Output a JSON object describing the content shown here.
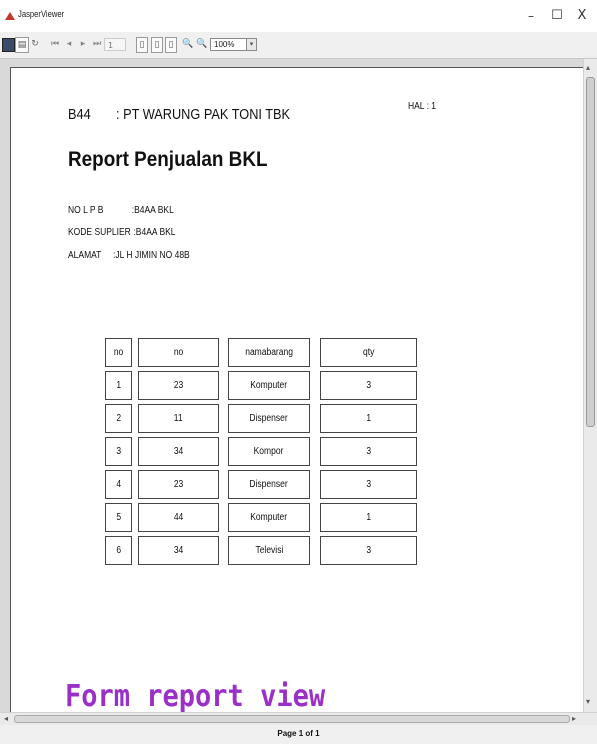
{
  "window": {
    "title": "JasperViewer",
    "minimize_glyph": "–",
    "maximize_glyph": "☐",
    "close_glyph": "X"
  },
  "toolbar": {
    "save_icon": "save-icon",
    "print_icon": "print-icon",
    "reload_glyph": "↻",
    "first_glyph": "⏮",
    "prev_glyph": "◂",
    "next_glyph": "▸",
    "last_glyph": "⏭",
    "page_number": "1",
    "fit_page_glyph": "▯",
    "actual_size_glyph": "▯",
    "fit_width_glyph": "▯",
    "zoom_in_glyph": "🔍",
    "zoom_out_glyph": "🔍",
    "zoom_value": "100%",
    "zoom_arrow": "▾"
  },
  "report": {
    "supplier_code": "B44",
    "company": ": PT WARUNG PAK TONI TBK",
    "hal": "HAL : 1",
    "title": "Report Penjualan BKL",
    "info": [
      {
        "label": "NO L P B",
        "value": ":B4AA BKL"
      },
      {
        "label": "KODE SUPLIER",
        "value": ":B4AA BKL"
      },
      {
        "label": "ALAMAT",
        "value": ":JL H JIMIN NO 48B"
      }
    ],
    "table": {
      "headers": [
        "no",
        "no",
        "namabarang",
        "qty"
      ],
      "rows": [
        [
          "1",
          "23",
          "Komputer",
          "3"
        ],
        [
          "2",
          "11",
          "Dispenser",
          "1"
        ],
        [
          "3",
          "34",
          "Kompor",
          "3"
        ],
        [
          "4",
          "23",
          "Dispenser",
          "3"
        ],
        [
          "5",
          "44",
          "Komputer",
          "1"
        ],
        [
          "6",
          "34",
          "Televisi",
          "3"
        ]
      ]
    }
  },
  "caption": "Form report view",
  "caption_color": "#9b30c9",
  "status": "Page 1 of 1",
  "scroll": {
    "up": "▴",
    "down": "▾",
    "left": "◂",
    "right": "▸"
  }
}
